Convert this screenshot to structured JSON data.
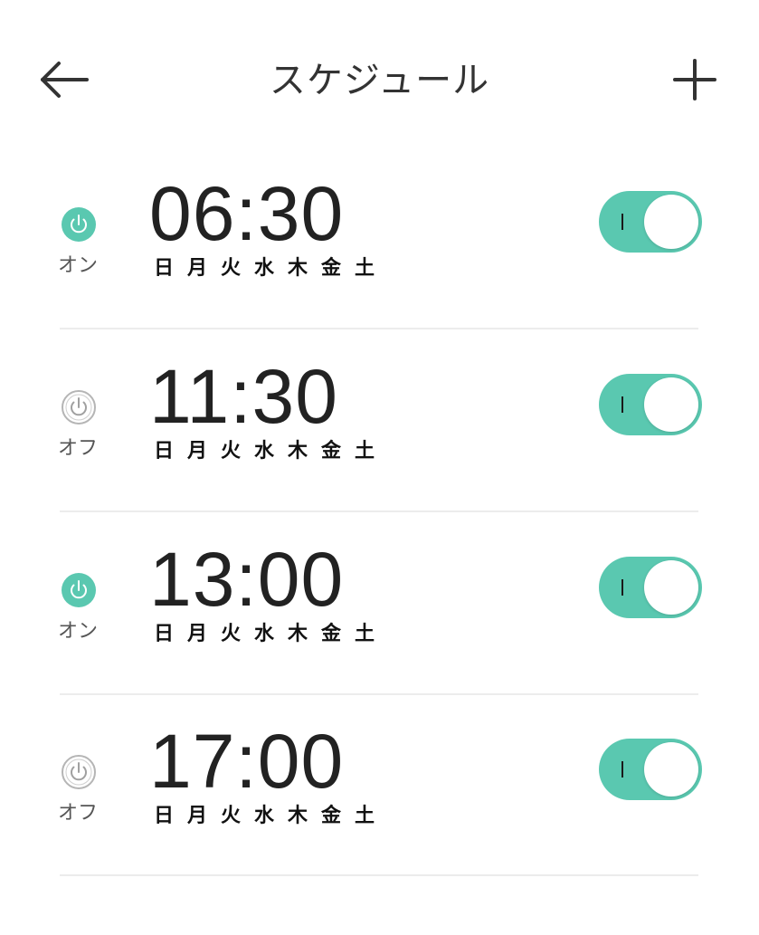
{
  "header": {
    "title": "スケジュール",
    "back_icon": "arrow-left-icon",
    "add_icon": "plus-icon"
  },
  "colors": {
    "accent": "#5ac8b0",
    "off_gray": "#b5b5b5"
  },
  "schedules": [
    {
      "time": "06:30",
      "state": "on",
      "state_label": "オン",
      "days": [
        "日",
        "月",
        "火",
        "水",
        "木",
        "金",
        "土"
      ],
      "enabled": true
    },
    {
      "time": "11:30",
      "state": "off",
      "state_label": "オフ",
      "days": [
        "日",
        "月",
        "火",
        "水",
        "木",
        "金",
        "土"
      ],
      "enabled": true
    },
    {
      "time": "13:00",
      "state": "on",
      "state_label": "オン",
      "days": [
        "日",
        "月",
        "火",
        "水",
        "木",
        "金",
        "土"
      ],
      "enabled": true
    },
    {
      "time": "17:00",
      "state": "off",
      "state_label": "オフ",
      "days": [
        "日",
        "月",
        "火",
        "水",
        "木",
        "金",
        "土"
      ],
      "enabled": true
    }
  ],
  "toggle_icon": "power-icon"
}
